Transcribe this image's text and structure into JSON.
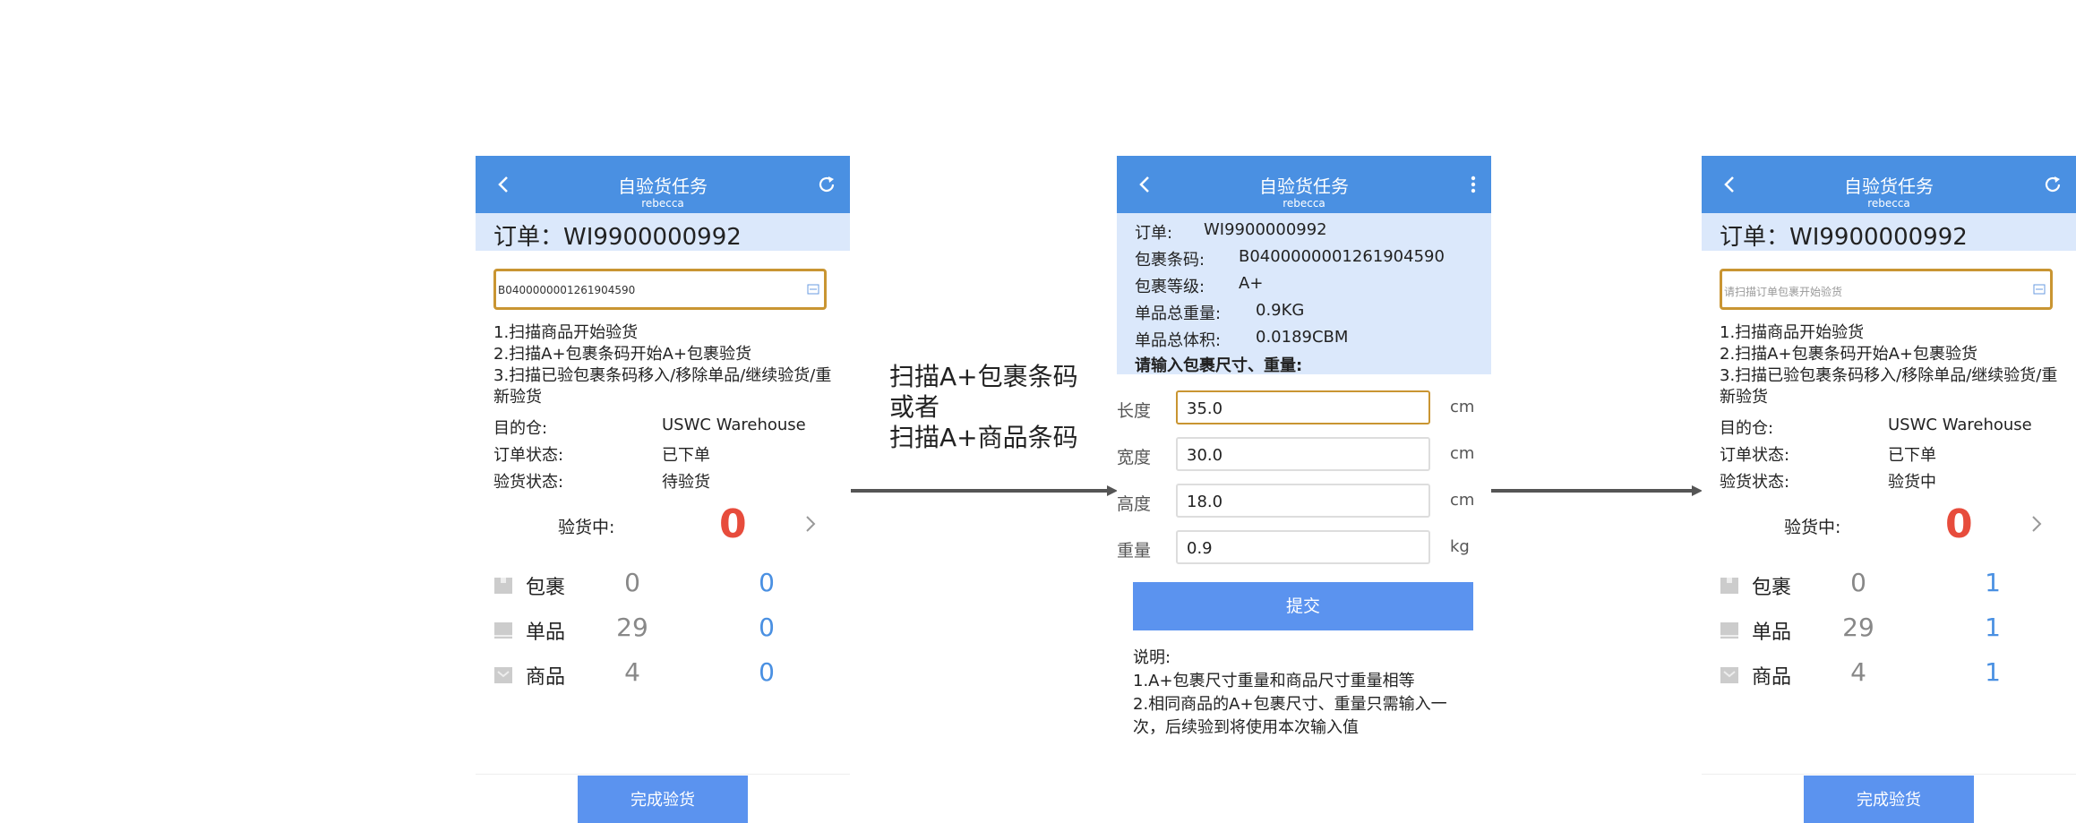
{
  "caption": [
    "扫描A+包裹条码",
    "或者",
    "扫描A+商品条码"
  ],
  "screen1": {
    "title": "自验货任务",
    "subtitle": "rebecca",
    "order": "订单：WI9900000992",
    "scan_value": "B0400000001261904590",
    "steps": [
      "1.扫描商品开始验货",
      "2.扫描A+包裹条码开始A+包裹验货",
      "3.扫描已验包裹条码移入/移除单品/继续验货/重新验货"
    ],
    "fields": [
      {
        "label": "目的仓:",
        "value": "USWC Warehouse"
      },
      {
        "label": "订单状态:",
        "value": "已下单"
      },
      {
        "label": "验货状态:",
        "value": "待验货"
      }
    ],
    "checking_label": "验货中:",
    "checking_count": "0",
    "rows": [
      {
        "name": "包裹",
        "a": "0",
        "b": "0",
        "icon": "package-icon"
      },
      {
        "name": "单品",
        "a": "29",
        "b": "0",
        "icon": "item-icon"
      },
      {
        "name": "商品",
        "a": "4",
        "b": "0",
        "icon": "product-icon"
      }
    ],
    "finish_label": "完成验货"
  },
  "screen2": {
    "title": "自验货任务",
    "subtitle": "rebecca",
    "info": [
      {
        "label": "订单:",
        "value": "WI9900000992"
      },
      {
        "label": "包裹条码:",
        "value": "B0400000001261904590"
      },
      {
        "label": "包裹等级:",
        "value": "A+"
      },
      {
        "label": "单品总重量:",
        "value": "0.9KG"
      },
      {
        "label": "单品总体积:",
        "value": "0.0189CBM"
      }
    ],
    "prompt": "请输入包裹尺寸、重量:",
    "form": [
      {
        "label": "长度",
        "value": "35.0",
        "unit": "cm"
      },
      {
        "label": "宽度",
        "value": "30.0",
        "unit": "cm"
      },
      {
        "label": "高度",
        "value": "18.0",
        "unit": "cm"
      },
      {
        "label": "重量",
        "value": "0.9",
        "unit": "kg"
      }
    ],
    "submit_label": "提交",
    "notes": [
      "说明:",
      "1.A+包裹尺寸重量和商品尺寸重量相等",
      "2.相同商品的A+包裹尺寸、重量只需输入一次，后续验到将使用本次输入值"
    ]
  },
  "screen3": {
    "title": "自验货任务",
    "subtitle": "rebecca",
    "order": "订单：WI9900000992",
    "scan_placeholder": "请扫描订单包裹开始验货",
    "steps": [
      "1.扫描商品开始验货",
      "2.扫描A+包裹条码开始A+包裹验货",
      "3.扫描已验包裹条码移入/移除单品/继续验货/重新验货"
    ],
    "fields": [
      {
        "label": "目的仓:",
        "value": "USWC Warehouse"
      },
      {
        "label": "订单状态:",
        "value": "已下单"
      },
      {
        "label": "验货状态:",
        "value": "验货中"
      }
    ],
    "checking_label": "验货中:",
    "checking_count": "0",
    "rows": [
      {
        "name": "包裹",
        "a": "0",
        "b": "1",
        "icon": "package-icon"
      },
      {
        "name": "单品",
        "a": "29",
        "b": "1",
        "icon": "item-icon"
      },
      {
        "name": "商品",
        "a": "4",
        "b": "1",
        "icon": "product-icon"
      }
    ],
    "finish_label": "完成验货"
  }
}
